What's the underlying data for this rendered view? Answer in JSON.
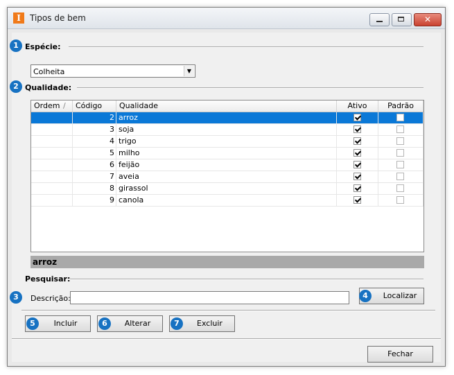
{
  "window": {
    "title": "Tipos de bem"
  },
  "badges": [
    "1",
    "2",
    "3",
    "4",
    "5",
    "6",
    "7"
  ],
  "especie": {
    "label": "Espécie:",
    "value": "Colheita"
  },
  "qualidade": {
    "label": "Qualidade:",
    "columns": [
      "Ordem",
      "Código",
      "Qualidade",
      "Ativo",
      "Padrão"
    ],
    "sort_indicator": "/",
    "rows": [
      {
        "codigo": "2",
        "qualidade": "arroz",
        "ativo": true,
        "padrao": false
      },
      {
        "codigo": "3",
        "qualidade": "soja",
        "ativo": true,
        "padrao": false
      },
      {
        "codigo": "4",
        "qualidade": "trigo",
        "ativo": true,
        "padrao": false
      },
      {
        "codigo": "5",
        "qualidade": "milho",
        "ativo": true,
        "padrao": false
      },
      {
        "codigo": "6",
        "qualidade": "feijão",
        "ativo": true,
        "padrao": false
      },
      {
        "codigo": "7",
        "qualidade": "aveia",
        "ativo": true,
        "padrao": false
      },
      {
        "codigo": "8",
        "qualidade": "girassol",
        "ativo": true,
        "padrao": false
      },
      {
        "codigo": "9",
        "qualidade": "canola",
        "ativo": true,
        "padrao": false
      }
    ],
    "selected_index": 0,
    "selected_detail": "arroz"
  },
  "pesquisar": {
    "label": "Pesquisar:",
    "descricao_label": "Descrição:",
    "descricao_value": "",
    "localizar_label": "Localizar"
  },
  "buttons": {
    "incluir": "Incluir",
    "alterar": "Alterar",
    "excluir": "Excluir",
    "fechar": "Fechar"
  },
  "colors": {
    "selection": "#0a78d7",
    "badge": "#1772c2",
    "app_icon": "#f07a1a"
  }
}
